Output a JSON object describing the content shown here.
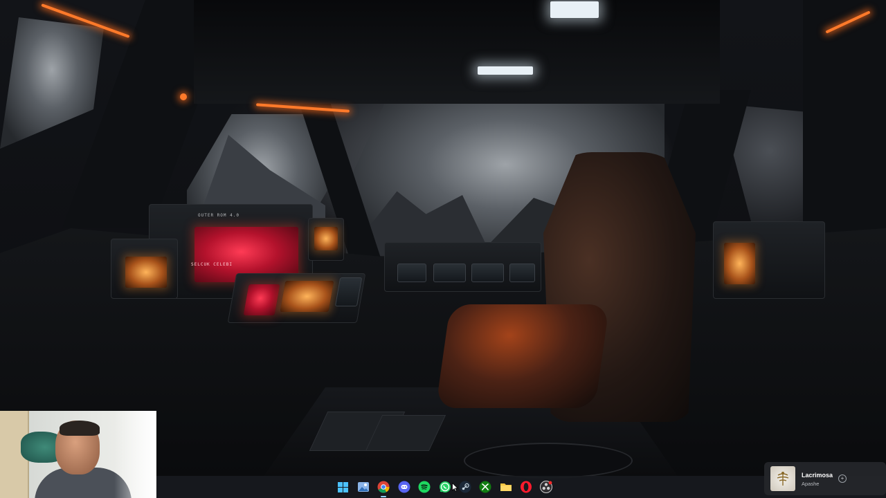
{
  "wallpaper": {
    "description_icon": "spaceship-cockpit-wallpaper",
    "left_screen_text": "SELCUK CELEBI",
    "panel_text": "OUTER ROM 4.0"
  },
  "webcam": {
    "icon": "webcam-feed"
  },
  "taskbar": {
    "apps": [
      {
        "name": "start-button",
        "icon": "windows-icon"
      },
      {
        "name": "photos-app",
        "icon": "photos-icon"
      },
      {
        "name": "chrome-app",
        "icon": "chrome-icon",
        "active": true
      },
      {
        "name": "discord-app",
        "icon": "discord-icon"
      },
      {
        "name": "spotify-app",
        "icon": "spotify-icon"
      },
      {
        "name": "whatsapp-app",
        "icon": "whatsapp-icon"
      },
      {
        "name": "steam-app",
        "icon": "steam-icon"
      },
      {
        "name": "xbox-app",
        "icon": "xbox-icon"
      },
      {
        "name": "file-explorer-app",
        "icon": "folder-icon"
      },
      {
        "name": "opera-app",
        "icon": "opera-icon"
      },
      {
        "name": "obs-app",
        "icon": "obs-icon"
      }
    ]
  },
  "media": {
    "title": "Lacrimosa",
    "artist": "Apashe",
    "album_icon": "album-art-icon",
    "action_icon": "expand-icon"
  },
  "colors": {
    "accent_glow": "#ff7a2a",
    "screen_red": "#d81e3c",
    "taskbar": "#181a1e"
  }
}
